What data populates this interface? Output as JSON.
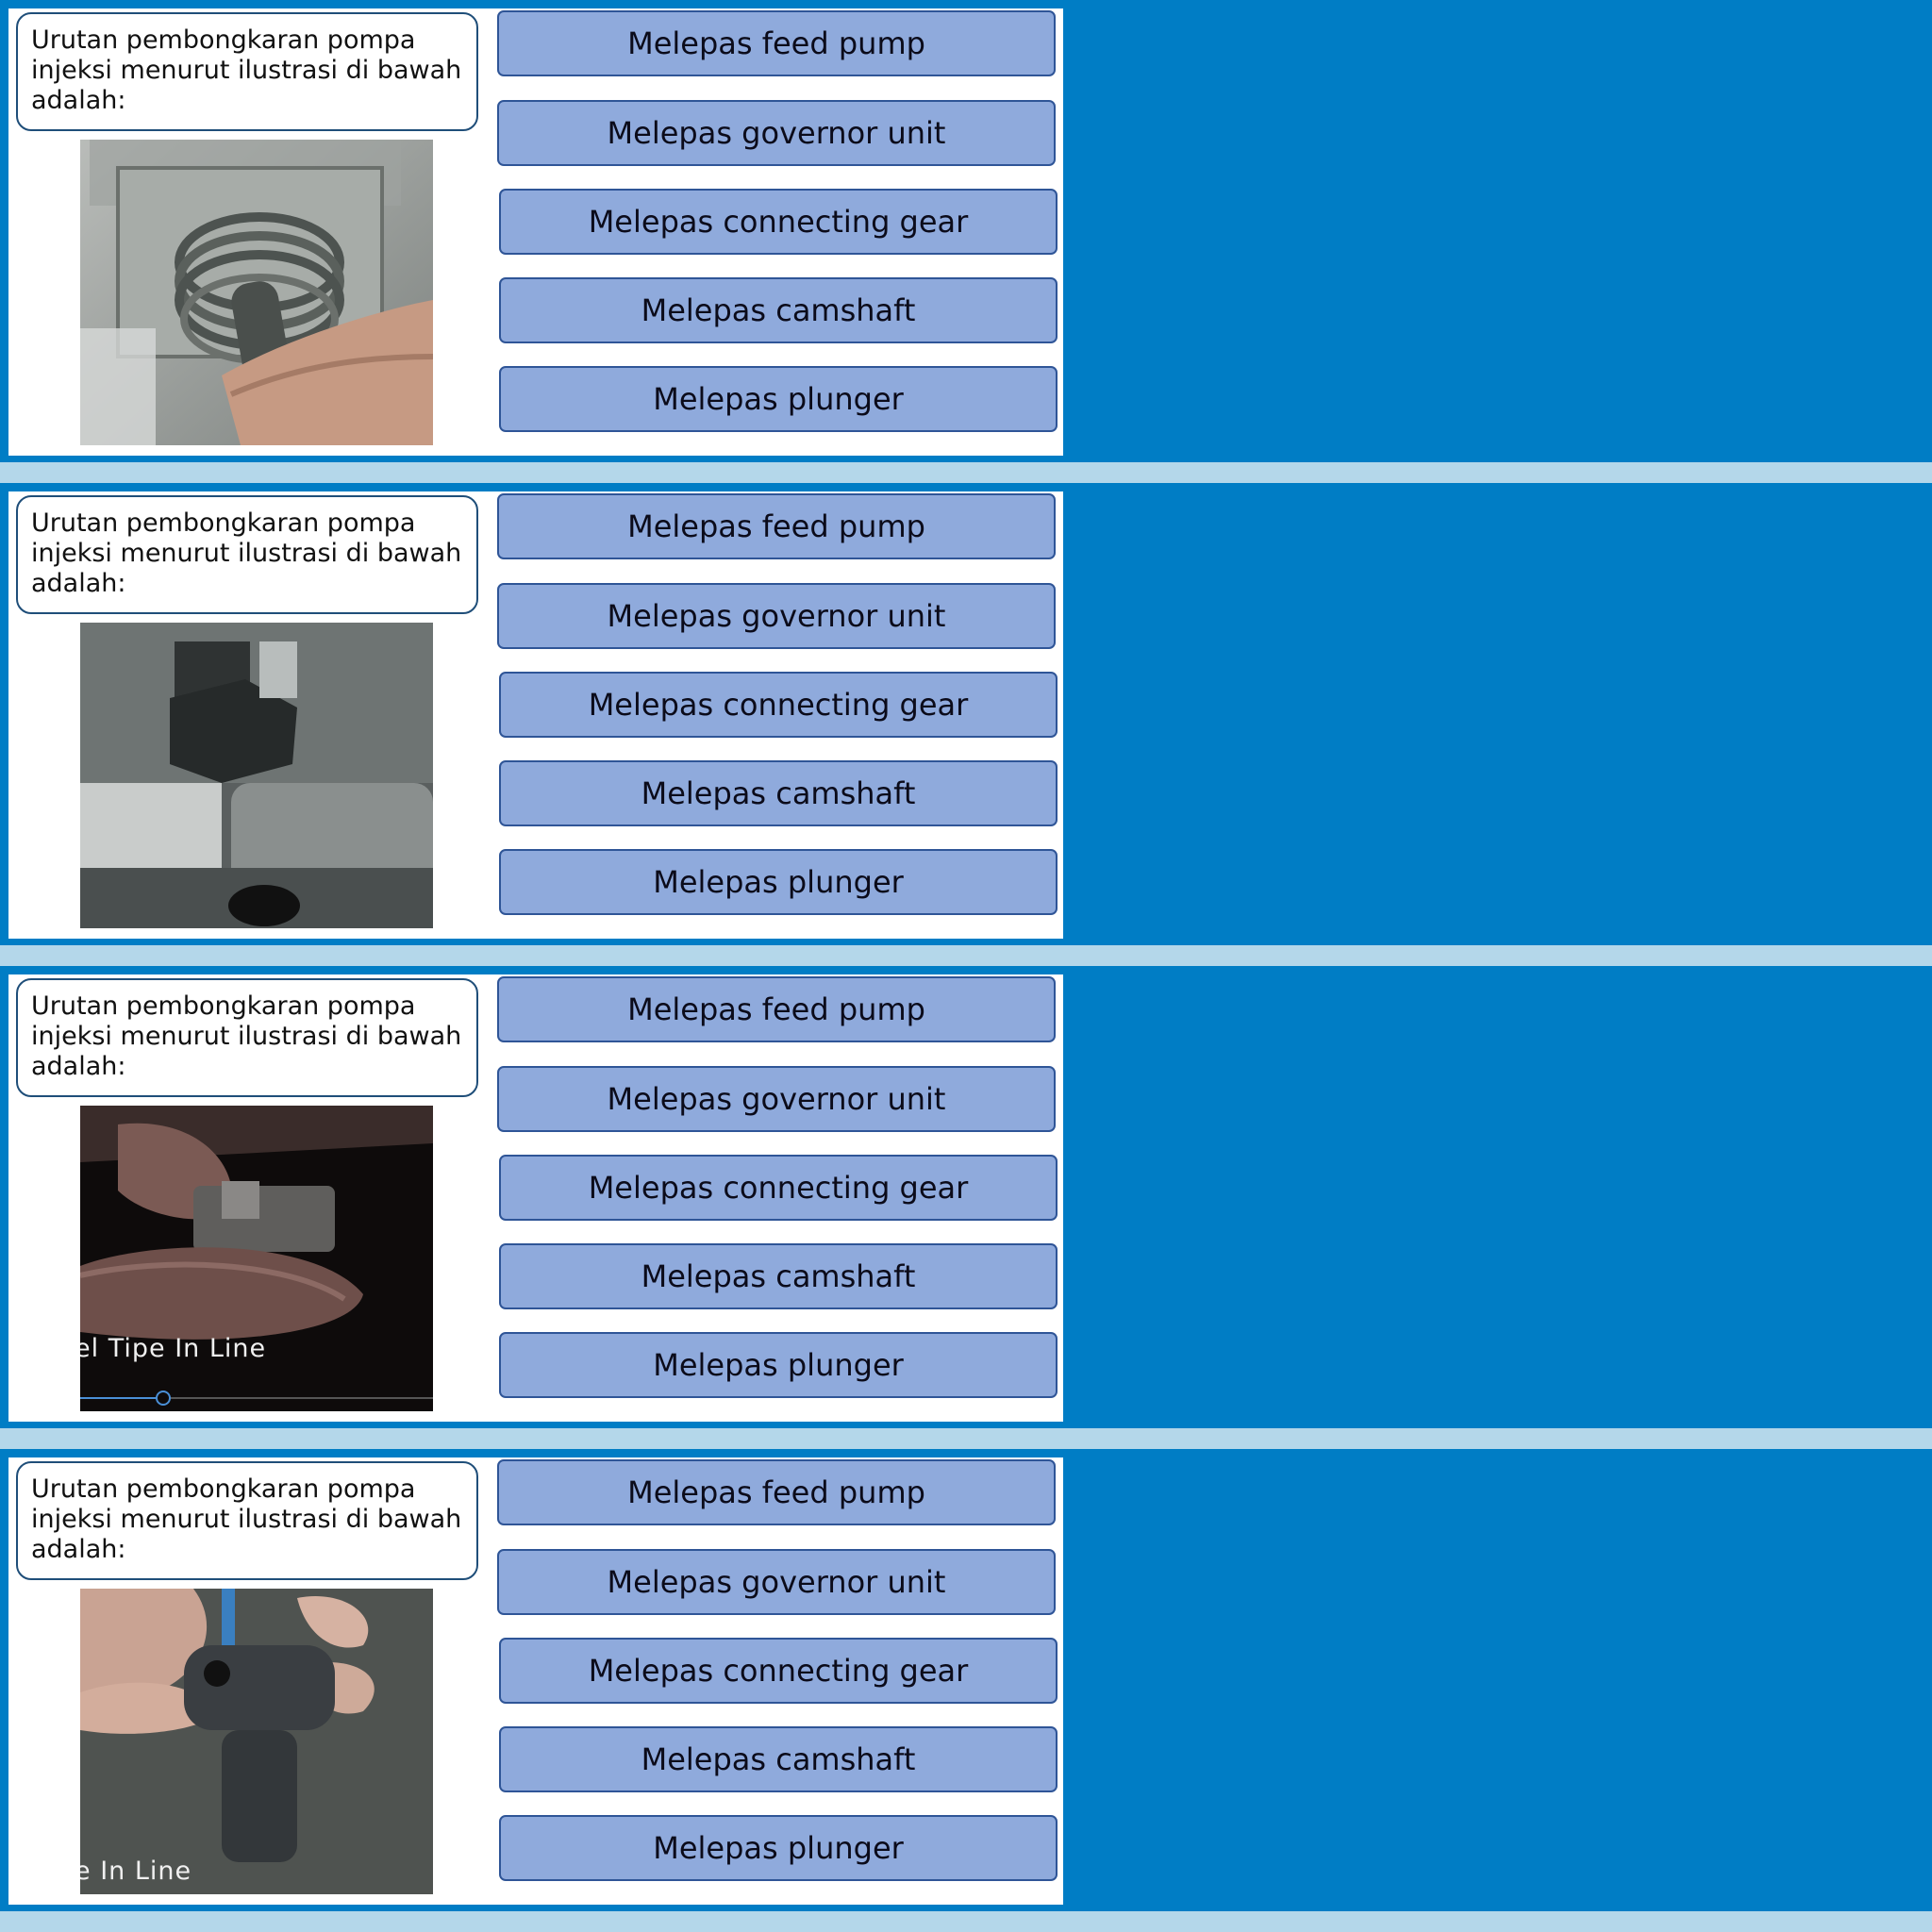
{
  "colors": {
    "background": "#b4d7ea",
    "band": "#007dc5",
    "panel": "#ffffff",
    "option_fill": "#8faadc",
    "option_border": "#2f5597",
    "question_border": "#1f4e79"
  },
  "questions": [
    {
      "prompt": "Urutan pembongkaran pompa injeksi menurut ilustrasi di bawah adalah:",
      "image_icon": "pump-spring-photo",
      "image_caption": "",
      "options": [
        "Melepas feed pump",
        "Melepas governor unit",
        "Melepas connecting gear",
        "Melepas camshaft",
        "Melepas plunger"
      ]
    },
    {
      "prompt": "Urutan pembongkaran pompa injeksi menurut ilustrasi di bawah adalah:",
      "image_icon": "pump-valve-holder-photo",
      "image_caption": "",
      "options": [
        "Melepas feed pump",
        "Melepas governor unit",
        "Melepas connecting gear",
        "Melepas camshaft",
        "Melepas plunger"
      ]
    },
    {
      "prompt": "Urutan pembongkaran pompa injeksi menurut ilustrasi di bawah adalah:",
      "image_icon": "pump-gear-photo",
      "image_caption": "el Tipe In Line",
      "options": [
        "Melepas feed pump",
        "Melepas governor unit",
        "Melepas connecting gear",
        "Melepas camshaft",
        "Melepas plunger"
      ]
    },
    {
      "prompt": "Urutan pembongkaran pompa injeksi menurut ilustrasi di bawah adalah:",
      "image_icon": "pump-plunger-photo",
      "image_caption": "e In Line",
      "options": [
        "Melepas feed pump",
        "Melepas governor unit",
        "Melepas connecting gear",
        "Melepas camshaft",
        "Melepas plunger"
      ]
    }
  ]
}
